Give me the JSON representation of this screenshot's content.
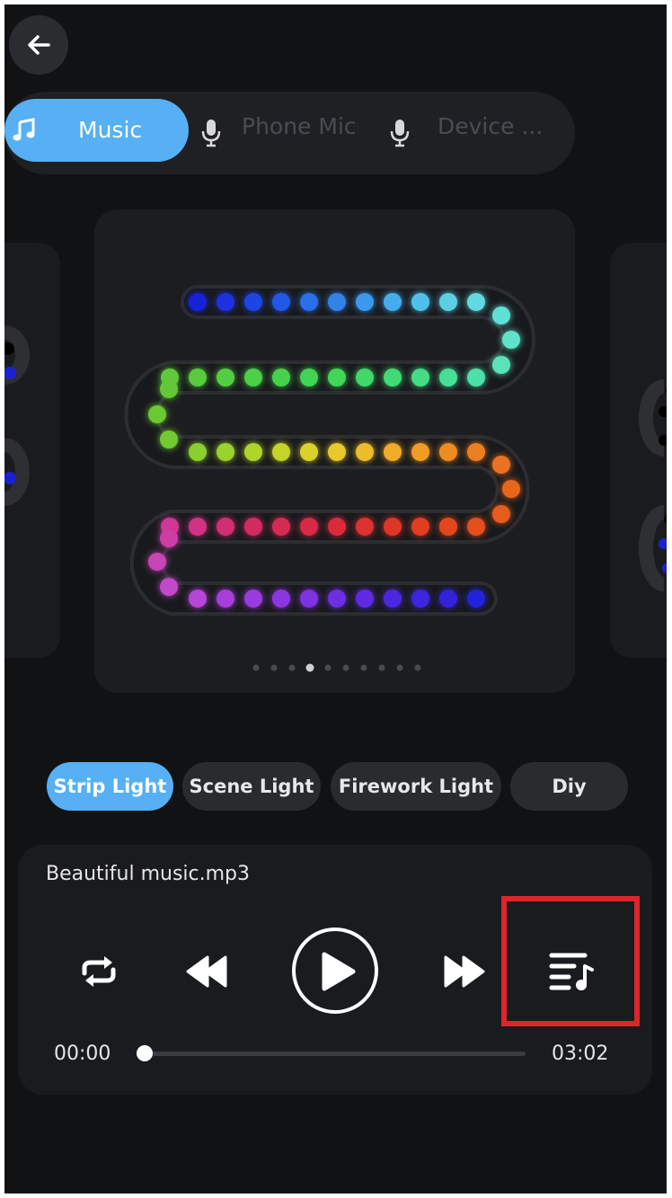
{
  "nav": {
    "back_icon": "arrow-left-icon"
  },
  "source_tabs": [
    {
      "label": "Music",
      "icon": "music-note-icon",
      "active": true
    },
    {
      "label": "Phone Mic",
      "icon": "microphone-icon",
      "active": false
    },
    {
      "label": "Device ...",
      "icon": "microphone-icon",
      "active": false
    }
  ],
  "preview": {
    "pager_count": 10,
    "pager_active": 3
  },
  "effect_categories": [
    {
      "label": "Strip Light",
      "active": true
    },
    {
      "label": "Scene Light",
      "active": false
    },
    {
      "label": "Firework Light",
      "active": false
    },
    {
      "label": "Diy",
      "active": false
    }
  ],
  "player": {
    "track": "Beautiful music.mp3",
    "current_time": "00:00",
    "total_time": "03:02",
    "progress": 0,
    "controls": [
      "repeat-icon",
      "rewind-icon",
      "play-icon",
      "fast-forward-icon",
      "playlist-icon"
    ]
  },
  "colors": {
    "accent": "#56b0f3",
    "background": "#111214",
    "highlight": "#e0242b"
  }
}
